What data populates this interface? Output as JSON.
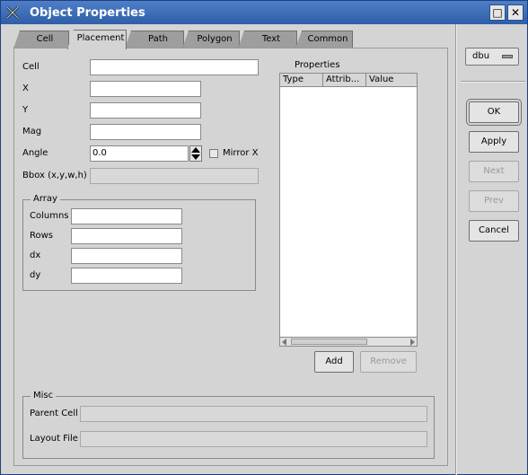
{
  "window": {
    "title": "Object Properties",
    "minimize_glyph": "□",
    "close_glyph": "✕",
    "icon": "app-x-icon"
  },
  "tabs": [
    {
      "label": "Cell"
    },
    {
      "label": "Placement",
      "active": true
    },
    {
      "label": "Path"
    },
    {
      "label": "Polygon"
    },
    {
      "label": "Text"
    },
    {
      "label": "Common"
    }
  ],
  "placement": {
    "cell_label": "Cell",
    "cell_value": "",
    "x_label": "X",
    "x_value": "",
    "y_label": "Y",
    "y_value": "",
    "mag_label": "Mag",
    "mag_value": "",
    "angle_label": "Angle",
    "angle_value": "0.0",
    "mirror_label": "Mirror X",
    "mirror_checked": false,
    "bbox_label": "Bbox (x,y,w,h)",
    "bbox_value": ""
  },
  "array": {
    "title": "Array",
    "columns_label": "Columns",
    "columns_value": "",
    "rows_label": "Rows",
    "rows_value": "",
    "dx_label": "dx",
    "dx_value": "",
    "dy_label": "dy",
    "dy_value": ""
  },
  "properties": {
    "title": "Properties",
    "columns": [
      "Type",
      "Attrib...",
      "Value"
    ],
    "rows": [],
    "add_label": "Add",
    "remove_label": "Remove"
  },
  "misc": {
    "title": "Misc",
    "parent_cell_label": "Parent Cell",
    "parent_cell_value": "",
    "layout_file_label": "Layout File",
    "layout_file_value": ""
  },
  "sidebar": {
    "units_value": "dbu",
    "ok_label": "OK",
    "apply_label": "Apply",
    "next_label": "Next",
    "prev_label": "Prev",
    "cancel_label": "Cancel"
  },
  "colors": {
    "titlebar": "#3566b3",
    "background": "#d4d4d4",
    "disabled_text": "#9a9a9a"
  }
}
